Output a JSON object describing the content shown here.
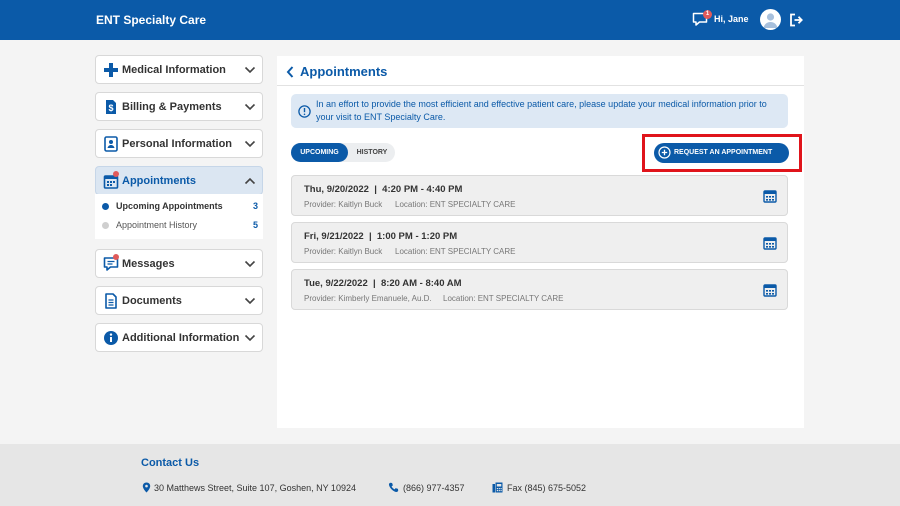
{
  "header": {
    "brand": "ENT Specialty Care",
    "notification_count": "1",
    "greeting": "Hi, Jane"
  },
  "sidebar": {
    "items": [
      {
        "label": "Medical Information",
        "icon": "plus-icon"
      },
      {
        "label": "Billing & Payments",
        "icon": "dollar-document-icon"
      },
      {
        "label": "Personal Information",
        "icon": "id-card-icon"
      },
      {
        "label": "Appointments",
        "icon": "calendar-icon",
        "active": true
      },
      {
        "label": "Messages",
        "icon": "chat-icon"
      },
      {
        "label": "Documents",
        "icon": "document-icon"
      },
      {
        "label": "Additional Information",
        "icon": "info-icon"
      }
    ],
    "subitems": [
      {
        "label": "Upcoming Appointments",
        "count": "3",
        "selected": true
      },
      {
        "label": "Appointment History",
        "count": "5",
        "selected": false
      }
    ]
  },
  "main": {
    "title": "Appointments",
    "info_text": "In an effort to provide the most efficient and effective patient care, please update your medical information prior to your visit to ENT Specialty Care.",
    "tabs": [
      "UPCOMING",
      "HISTORY"
    ],
    "request_button": "REQUEST AN APPOINTMENT",
    "appointments": [
      {
        "datetime": "Thu, 9/20/2022  |  4:20 PM - 4:40 PM",
        "provider": "Provider: Kaitlyn Buck",
        "location": "Location: ENT SPECIALTY CARE"
      },
      {
        "datetime": "Fri, 9/21/2022  |  1:00 PM - 1:20 PM",
        "provider": "Provider: Kaitlyn Buck",
        "location": "Location: ENT SPECIALTY CARE"
      },
      {
        "datetime": "Tue, 9/22/2022  |  8:20 AM - 8:40 AM",
        "provider": "Provider: Kimberly Emanuele, Au.D.",
        "location": "Location: ENT SPECIALTY CARE"
      }
    ]
  },
  "footer": {
    "title": "Contact Us",
    "address": "30 Matthews Street, Suite 107, Goshen, NY 10924",
    "phone": "(866) 977-4357",
    "fax": "Fax (845) 675-5052"
  },
  "colors": {
    "brand_blue": "#0b5aa8",
    "highlight_red": "#e0141b",
    "alert_red": "#e05a5a"
  }
}
